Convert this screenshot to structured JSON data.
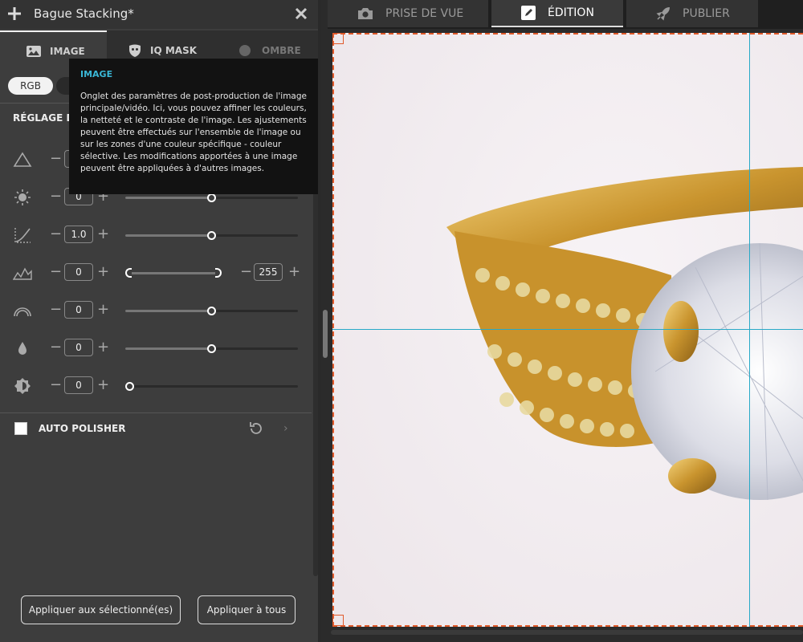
{
  "window": {
    "title": "Bague Stacking*"
  },
  "left_tabs": [
    {
      "label": "IMAGE",
      "icon": "image-icon",
      "active": true
    },
    {
      "label": "IQ MASK",
      "icon": "mask-icon",
      "active": false
    },
    {
      "label": "OMBRE",
      "icon": "shadow-icon",
      "active": false
    }
  ],
  "color_mode": {
    "rgb_label": "RGB"
  },
  "section": {
    "title": "RÉGLAGE D'"
  },
  "adjustments": [
    {
      "icon": "levels-icon",
      "value": "",
      "level": 0.5
    },
    {
      "icon": "brightness-icon",
      "value": "0",
      "level": 0.5
    },
    {
      "icon": "curve-icon",
      "value": "1.0",
      "level": 0.5
    },
    {
      "icon": "histogram-icon",
      "value": "0",
      "value_max": "255",
      "range": [
        0,
        255
      ]
    },
    {
      "icon": "saturation-icon",
      "value": "0",
      "level": 0.5
    },
    {
      "icon": "drop-icon",
      "value": "0",
      "level": 0.5
    },
    {
      "icon": "contrast-icon",
      "value": "0",
      "level": 0.0
    }
  ],
  "auto_polisher": {
    "label": "AUTO POLISHER",
    "checked": false
  },
  "buttons": {
    "apply_selected": "Appliquer aux sélectionné(es)",
    "apply_all": "Appliquer à tous"
  },
  "tooltip": {
    "title": "IMAGE",
    "body": "Onglet des paramètres de post-production de l'image principale/vidéo. Ici, vous pouvez affiner les couleurs, la netteté et le contraste de l'image. Les ajustements peuvent être effectués sur l'ensemble de l'image ou sur les zones d'une couleur spécifique - couleur sélective. Les modifications apportées à une image peuvent être appliquées à d'autres images."
  },
  "top_tabs": [
    {
      "label": "PRISE DE VUE",
      "icon": "camera-icon",
      "active": false
    },
    {
      "label": "ÉDITION",
      "icon": "edit-icon",
      "active": true
    },
    {
      "label": "PUBLIER",
      "icon": "rocket-icon",
      "active": false
    }
  ],
  "colors": {
    "accent": "#28a9c7",
    "tooltip_title": "#3ab7d6",
    "selection": "#e05a2b",
    "panel": "#3d3d3d"
  }
}
